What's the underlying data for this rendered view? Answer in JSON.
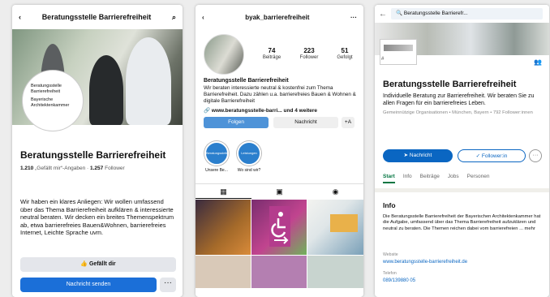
{
  "facebook": {
    "back_icon": "‹",
    "title": "Beratungsstelle Barrierefreiheit",
    "search_icon": "⌕",
    "avatar_lines": [
      "Beratungsstelle",
      "Barrierefreiheit",
      "Bayerische",
      "Architektenkammer"
    ],
    "name": "Beratungsstelle Barrierefreiheit",
    "likes_count": "1.210",
    "likes_label": "„Gefällt mir“-Angaben ·",
    "followers_count": "1.257",
    "followers_label": "Follower",
    "description": "Wir haben ein klares Anliegen: Wir wollen umfassend über das Thema Barrierefreiheit aufklären & interessierte neutral beraten. Wir decken ein breites Themenspektrum ab, etwa barrierefreies Bauen&Wohnen, barrierefreies Internet, Leichte Sprache uvm.",
    "like_button": "👍 Gefällt dir",
    "message_button": "Nachricht senden",
    "more_button": "···"
  },
  "instagram": {
    "back_icon": "‹",
    "handle": "byak_barrierefreiheit",
    "more_icon": "···",
    "stats": [
      {
        "value": "74",
        "label": "Beiträge"
      },
      {
        "value": "223",
        "label": "Follower"
      },
      {
        "value": "51",
        "label": "Gefolgt"
      }
    ],
    "name": "Beratungsstelle Barrierefreiheit",
    "bio": "Wir beraten interessierte neutral & kostenfrei zum Thema Barrierefreiheit. Dazu zählen u.a. barrierefreies Bauen & Wohnen & digitale Barrierefreiheit",
    "link": "🔗 www.beratungsstelle-barri... und 4 weitere",
    "follow_button": "Folgen",
    "message_button": "Nachricht",
    "add_button": "+A",
    "highlights": [
      {
        "circle_text": "Beratungsstelle",
        "label": "Unsere Be..."
      },
      {
        "circle_text": "Leistungen",
        "label": "Wo sind wir?"
      }
    ],
    "tabs": [
      "▦",
      "▣",
      "◉"
    ]
  },
  "linkedin": {
    "back_icon": "←",
    "search_text": "🔍 Beratungsstelle Barrierefr...",
    "q_label": "#",
    "people_icon": "👥",
    "name": "Beratungsstelle Barrierefreiheit",
    "tagline": "Individuelle Beratung zur Barrierefreiheit. Wir beraten Sie zu allen Fragen für ein barrierefreies Leben.",
    "meta": "Gemeinnützige Organisationen • München, Bayern • 792 Follower:innen",
    "message_button": "➤ Nachricht",
    "follow_button": "✓ Follower:in",
    "more_button": "···",
    "tabs": [
      "Start",
      "Info",
      "Beiträge",
      "Jobs",
      "Personen"
    ],
    "info_heading": "Info",
    "info_text": "Die Beratungsstelle Barrierefreiheit der Bayerischen Architektenkammer hat die Aufgabe, umfassend über das Thema Barrierefreiheit aufzuklären und neutral zu beraten. Die Themen reichen dabei vom barrierefreien ... mehr",
    "website_label": "Website",
    "website": "www.beratungsstelle-barrierefreiheit.de",
    "phone_label": "Telefon",
    "phone": "089/139880 05"
  }
}
